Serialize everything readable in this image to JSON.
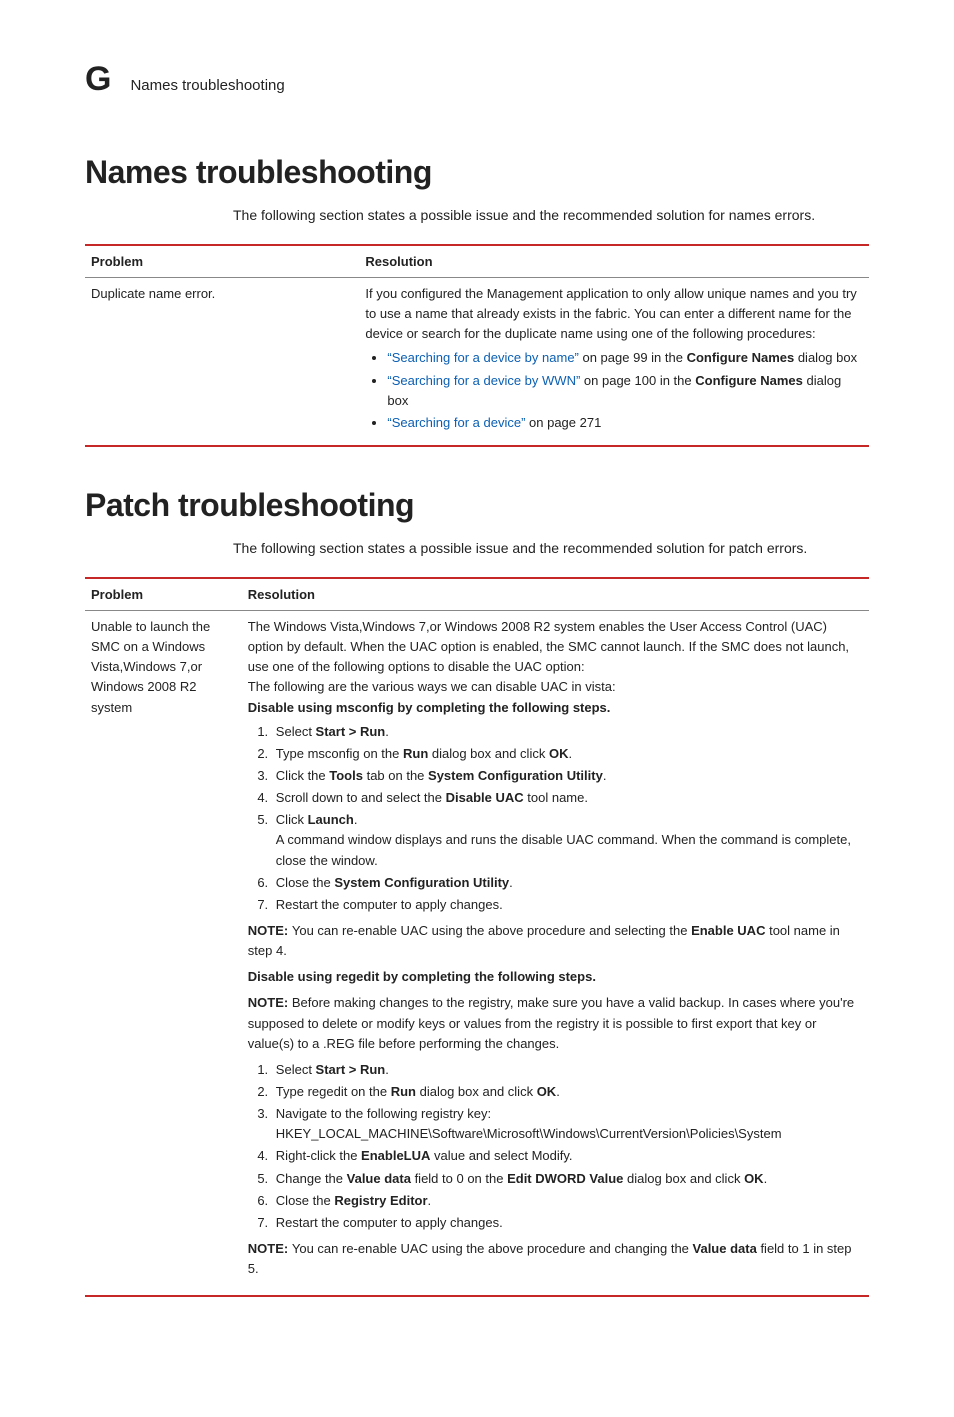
{
  "header": {
    "appendix_letter": "G",
    "title": "Names troubleshooting"
  },
  "names": {
    "heading": "Names troubleshooting",
    "intro": "The following section states a possible issue and the recommended solution for names errors.",
    "th_problem": "Problem",
    "th_resolution": "Resolution",
    "row1": {
      "problem": "Duplicate name error.",
      "resolution_p": "If you configured the Management application to only allow unique names and you try to use a name that already exists in the fabric. You can enter a different name for the device or search for the duplicate name using one of the following procedures:",
      "bullets": [
        {
          "link": "“Searching for a device by name”",
          "tail_a": " on page 99 in the ",
          "bold": "Configure Names",
          "tail_b": " dialog box"
        },
        {
          "link": "“Searching for a device by WWN”",
          "tail_a": " on page 100 in the ",
          "bold": "Configure Names",
          "tail_b": " dialog box"
        },
        {
          "link": "“Searching for a device”",
          "tail_a": " on page 271",
          "bold": "",
          "tail_b": ""
        }
      ]
    }
  },
  "patch": {
    "heading": "Patch troubleshooting",
    "intro": "The following section states a possible issue and the recommended solution for patch errors.",
    "th_problem": "Problem",
    "th_resolution": "Resolution",
    "row1": {
      "problem": "Unable to launch the SMC on a Windows Vista,Windows 7,or Windows 2008 R2 system",
      "p1": "The Windows Vista,Windows 7,or Windows 2008 R2 system enables the User Access Control (UAC) option by default. When the UAC option is enabled, the SMC cannot launch. If the SMC does not launch, use one of the following options to disable the UAC option:",
      "p2": "The following are the various ways we can disable UAC in vista:",
      "sub1_title": "Disable using msconfig by completing the following steps.",
      "sub1_steps": {
        "s1a": "Select ",
        "s1b": "Start > Run",
        "s1c": ".",
        "s2a": "Type msconfig on the ",
        "s2b": "Run",
        "s2c": " dialog box and click ",
        "s2d": "OK",
        "s2e": ".",
        "s3a": "Click the ",
        "s3b": "Tools",
        "s3c": " tab on the ",
        "s3d": "System Configuration Utility",
        "s3e": ".",
        "s4a": "Scroll down to and select the ",
        "s4b": "Disable UAC",
        "s4c": " tool name.",
        "s5a": "Click ",
        "s5b": "Launch",
        "s5c": ".",
        "s5sub": "A command window displays and runs the disable UAC command. When the command is complete, close the window.",
        "s6a": "Close the ",
        "s6b": "System Configuration Utility",
        "s6c": ".",
        "s7": "Restart the computer to apply changes."
      },
      "note1_label": "NOTE:",
      "note1_text_a": "You can re-enable UAC using the above procedure and selecting the ",
      "note1_bold": "Enable UAC",
      "note1_text_b": " tool name in step 4.",
      "sub2_title": "Disable using regedit by completing the following steps.",
      "note2_label": "NOTE:",
      "note2_text": "Before making changes to the registry, make sure you have a valid backup. In cases where you're supposed to delete or modify keys or values from the registry it is possible to first export that key or value(s) to a .REG file before performing the changes.",
      "sub2_steps": {
        "s1a": "Select ",
        "s1b": "Start > Run",
        "s1c": ".",
        "s2a": "Type regedit on the ",
        "s2b": "Run",
        "s2c": " dialog box and click ",
        "s2d": "OK",
        "s2e": ".",
        "s3a": "Navigate to the following registry key:",
        "s3b": "HKEY_LOCAL_MACHINE\\Software\\Microsoft\\Windows\\CurrentVersion\\Policies\\System",
        "s4a": "Right-click the ",
        "s4b": "EnableLUA",
        "s4c": " value and select Modify.",
        "s5a": "Change the ",
        "s5b": "Value data",
        "s5c": " field to 0 on the ",
        "s5d": "Edit DWORD Value",
        "s5e": " dialog box and click ",
        "s5f": "OK",
        "s5g": ".",
        "s6a": "Close the ",
        "s6b": "Registry Editor",
        "s6c": ".",
        "s7": "Restart the computer to apply changes."
      },
      "note3_label": "NOTE:",
      "note3_text_a": "You can re-enable UAC using the above procedure and changing the ",
      "note3_bold": "Value data",
      "note3_text_b": " field to 1 in step 5."
    }
  }
}
